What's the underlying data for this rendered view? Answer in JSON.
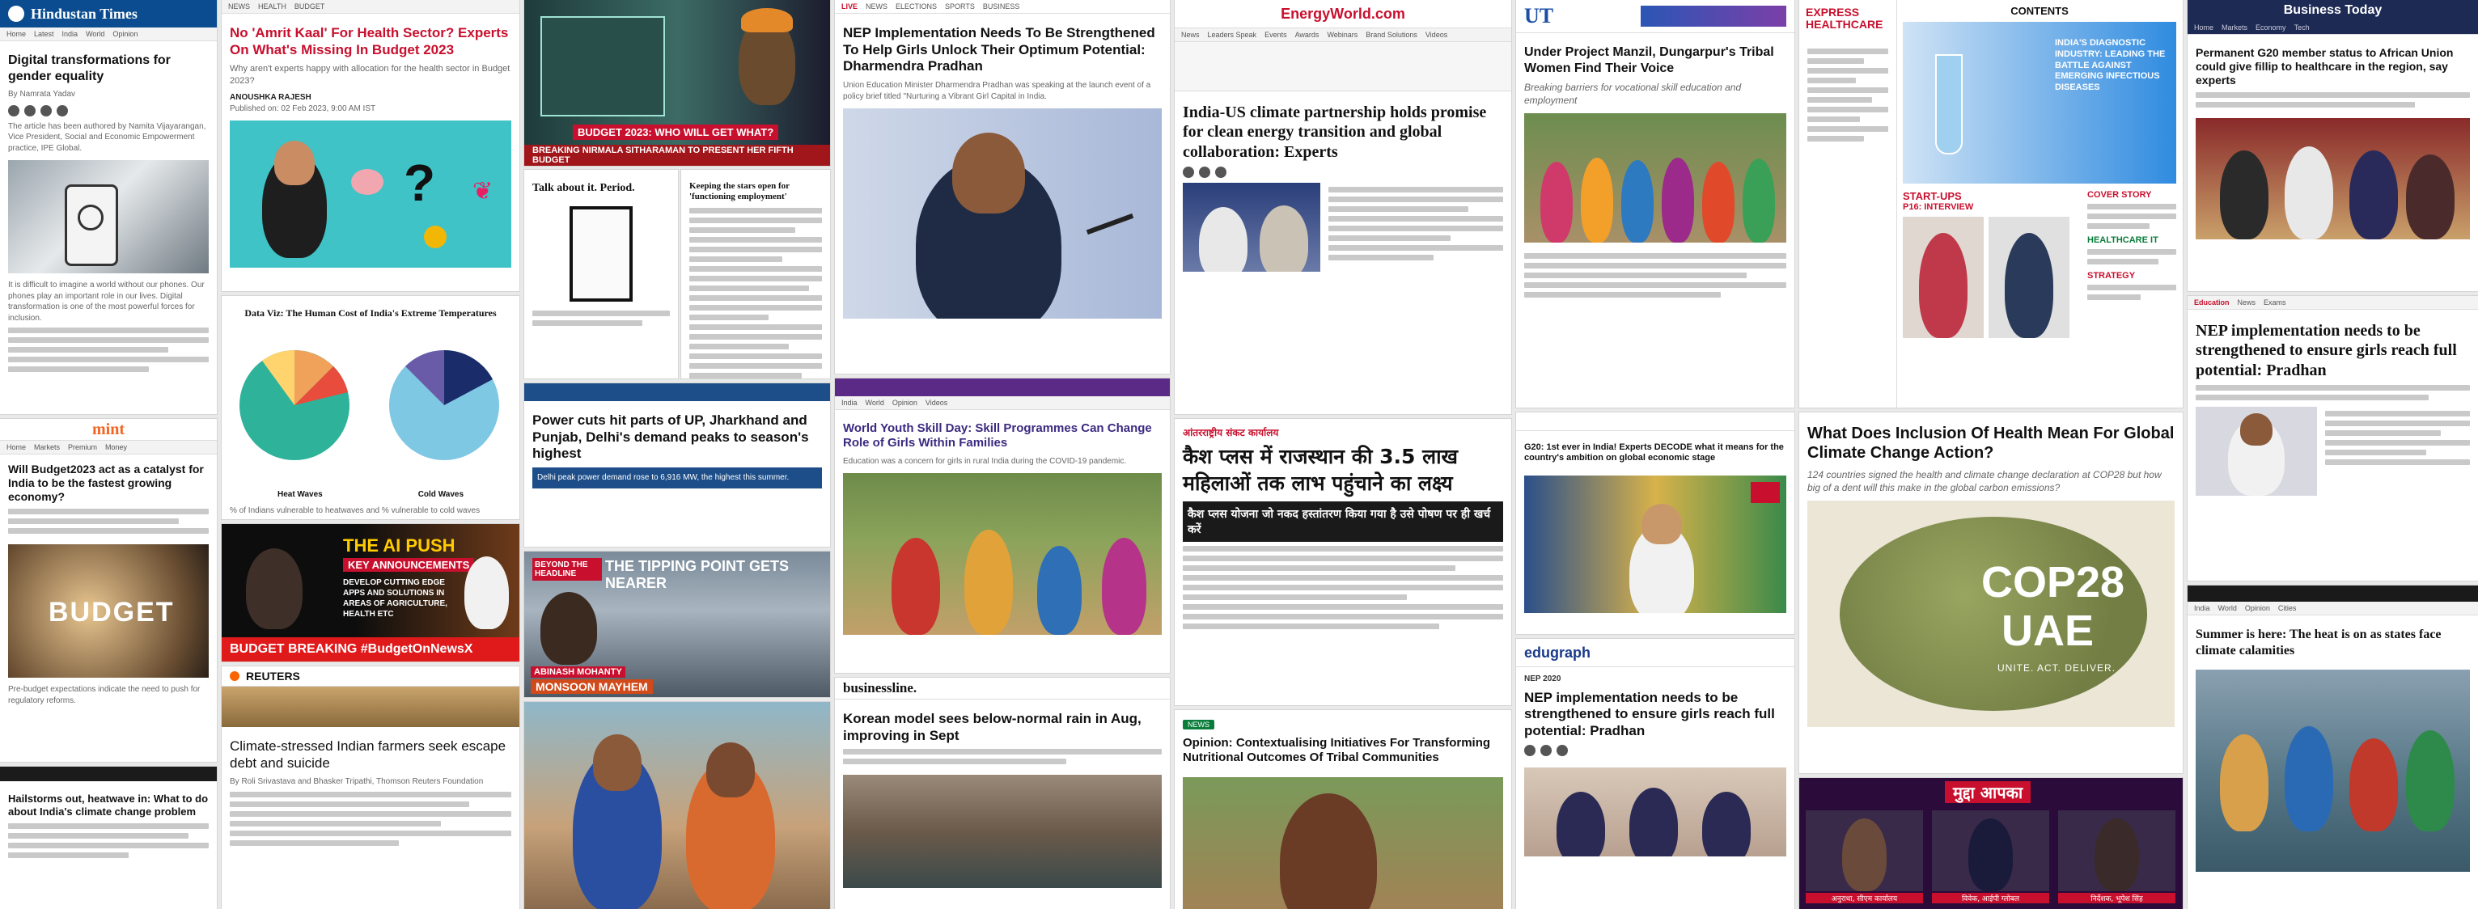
{
  "ht": {
    "logo": "Hindustan Times",
    "headline": "Digital transformations for gender equality",
    "byline": "By Namrata Yadav",
    "intro": "The article has been authored by Namita Vijayarangan, Vice President, Social and Economic Empowerment practice, IPE Global.",
    "body": "It is difficult to imagine a world without our phones. Our phones play an important role in our lives. Digital transformation is one of the most powerful forces for inclusion."
  },
  "nak": {
    "headline": "No 'Amrit Kaal' For Health Sector? Experts On What's Missing In Budget 2023",
    "sub": "Why aren't experts happy with allocation for the health sector in Budget 2023?",
    "author": "ANOUSHKA RAJESH",
    "date": "Published on: 02 Feb 2023, 9:00 AM IST"
  },
  "budgetvid": {
    "caption": "BUDGET 2023: WHO WILL GET WHAT?",
    "ticker": "BREAKING NIRMALA SITHARAMAN TO PRESENT HER FIFTH BUDGET"
  },
  "talk": {
    "title": "Talk about it. Period.",
    "side": "Keeping the stars open for 'functioning employment'"
  },
  "nep1": {
    "headline": "NEP Implementation Needs To Be Strengthened To Help Girls Unlock Their Optimum Potential: Dharmendra Pradhan",
    "sub": "Union Education Minister Dharmendra Pradhan was speaking at the launch event of a policy brief titled \"Nurturing a Vibrant Girl Capital in India."
  },
  "energy": {
    "logo": "EnergyWorld.com",
    "headline": "India-US climate partnership holds promise for clean energy transition and global collaboration: Experts",
    "nav": [
      "News",
      "Leaders Speak",
      "Events",
      "Awards",
      "Webinars",
      "Brand Solutions",
      "Videos"
    ]
  },
  "ut": {
    "logo": "UT",
    "headline": "Under Project Manzil, Dungarpur's Tribal Women Find Their Voice",
    "sub": "Breaking barriers for vocational skill education and employment"
  },
  "eh": {
    "logo": "EXPRESS HEALTHCARE",
    "contents": "CONTENTS",
    "cover": "INDIA'S DIAGNOSTIC INDUSTRY: LEADING THE BATTLE AGAINST EMERGING INFECTIOUS DISEASES",
    "startups": "START-UPS",
    "interview": "P16: INTERVIEW",
    "cover_story": "COVER STORY",
    "healthcare_it": "HEALTHCARE IT",
    "strategy": "STRATEGY"
  },
  "bt": {
    "logo": "Business Today",
    "headline": "Permanent G20 member status to African Union could give fillip to healthcare in the region, say experts",
    "nep_headline": "NEP implementation needs to be strengthened to ensure girls reach full potential: Pradhan",
    "ie_headline": "Summer is here: The heat is on as states face climate calamities"
  },
  "mint": {
    "logo": "mint",
    "headline": "Will Budget2023 act as a catalyst for India to be the fastest growing economy?",
    "image_word": "BUDGET",
    "body": "Pre-budget expectations indicate the need to push for regulatory reforms."
  },
  "heatwave": {
    "headline": "Hailstorms out, heatwave in: What to do about India's climate change problem"
  },
  "dataviz": {
    "title": "Data Viz: The Human Cost of India's Extreme Temperatures",
    "label_a": "Heat Waves",
    "label_b": "Cold Waves",
    "footer": "% of Indians vulnerable to heatwaves and % vulnerable to cold waves"
  },
  "aipush": {
    "title": "THE AI PUSH",
    "sub": "KEY ANNOUNCEMENTS",
    "points": "DEVELOP CUTTING EDGE APPS AND SOLUTIONS IN AREAS OF AGRICULTURE, HEALTH ETC",
    "ticker": "BUDGET BREAKING #BudgetOnNewsX"
  },
  "reuters": {
    "logo": "REUTERS",
    "headline": "Climate-stressed Indian farmers seek escape debt and suicide",
    "byline": "By Roli Srivastava and Bhasker Tripathi, Thomson Reuters Foundation"
  },
  "power": {
    "headline": "Power cuts hit parts of UP, Jharkhand and Punjab, Delhi's demand peaks to season's highest",
    "sub": "Delhi peak power demand rose to 6,916 MW, the highest this summer."
  },
  "tipping": {
    "banner": "THE TIPPING POINT GETS NEARER",
    "beyond": "BEYOND THE HEADLINE",
    "name": "ABINASH MOHANTY",
    "ticker": "MONSOON MAYHEM"
  },
  "youth": {
    "headline": "World Youth Skill Day: Skill Programmes Can Change Role of Girls Within Families",
    "sub": "Education was a concern for girls in rural India during the COVID-19 pandemic."
  },
  "hindi": {
    "headline": "कैश प्लस में राजस्थान की 3.5 लाख महिलाओं तक लाभ पहुंचाने का लक्ष्य",
    "top": "आंतरराष्ट्रीय संकट कार्यालय",
    "box": "कैश प्लस योजना जो नकद हस्तांतरण किया गया है उसे पोषण पर ही खर्च करें"
  },
  "fe": {
    "headline": "G20: 1st ever in India! Experts DECODE what it means for the country's ambition on global economic stage"
  },
  "health": {
    "headline": "What Does Inclusion Of Health Mean For Global Climate Change Action?",
    "sub": "124 countries signed the health and climate change declaration at COP28 but how big of a dent will this make in the global carbon emissions?",
    "cop": "COP28",
    "uae": "UAE",
    "tag": "UNITE. ACT. DELIVER."
  },
  "telegraph": {
    "logo": "edugraph",
    "headline": "NEP implementation needs to be strengthened to ensure girls reach full potential: Pradhan",
    "label": "NEP 2020"
  },
  "businessline": {
    "logo": "businessline.",
    "headline": "Korean model sees below-normal rain in Aug, improving in Sept"
  },
  "opinion": {
    "tag": "NEWS",
    "headline": "Opinion: Contextualising Initiatives For Transforming Nutritional Outcomes Of Tribal Communities"
  },
  "hindi_tv": {
    "title": "मुद्दा आपका",
    "names": [
      "अनुराधा, सीएम कार्यालय",
      "विवेक, आईपी ग्लोबल",
      "निर्देशक, भूपेश सिंह"
    ]
  },
  "colors": {
    "ht_blue": "#0a4c8f",
    "nav_red": "#c8102e",
    "mint_orange": "#f26522",
    "ndtv_red": "#e0191b",
    "cop_green": "#8a9a4b",
    "bt_navy": "#1d2a54"
  }
}
